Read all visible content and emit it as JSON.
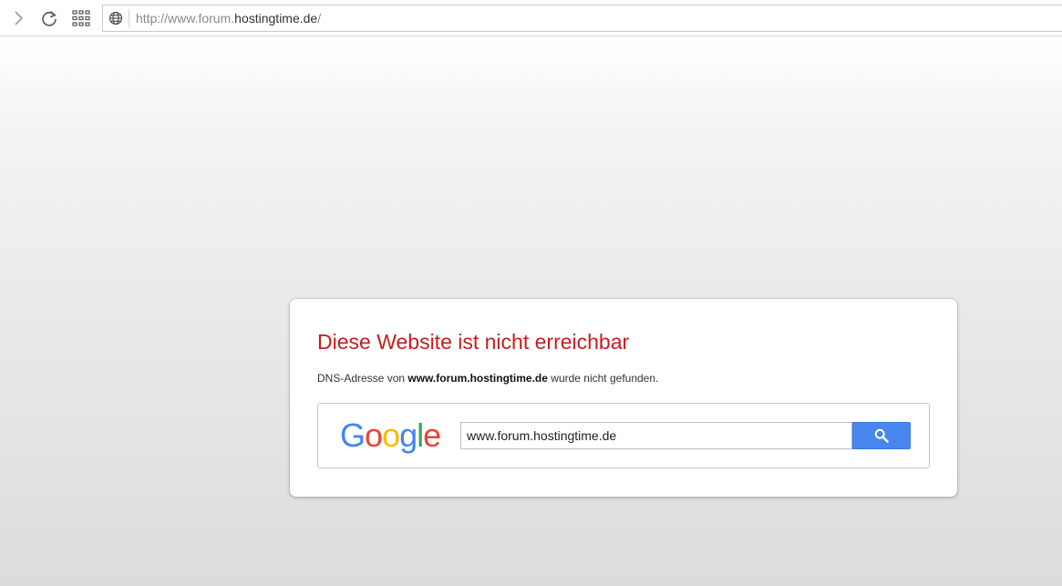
{
  "toolbar": {
    "forward_icon": "chevron-right-icon",
    "reload_icon": "reload-icon",
    "apps_icon": "apps-grid-icon"
  },
  "address_bar": {
    "icon": "globe-icon",
    "url_prefix": "http://www.forum.",
    "url_host": "hostingtime.de",
    "url_suffix": "/"
  },
  "error_card": {
    "title": "Diese Website ist nicht erreichbar",
    "desc_before": "DNS-Adresse von ",
    "desc_domain": "www.forum.hostingtime.de",
    "desc_after": " wurde nicht gefunden.",
    "title_color": "#c61d1d"
  },
  "google_search": {
    "logo_letters": [
      "G",
      "o",
      "o",
      "g",
      "l",
      "e"
    ],
    "query": "www.forum.hostingtime.de",
    "button_icon": "search-icon",
    "button_color": "#4787ed"
  }
}
